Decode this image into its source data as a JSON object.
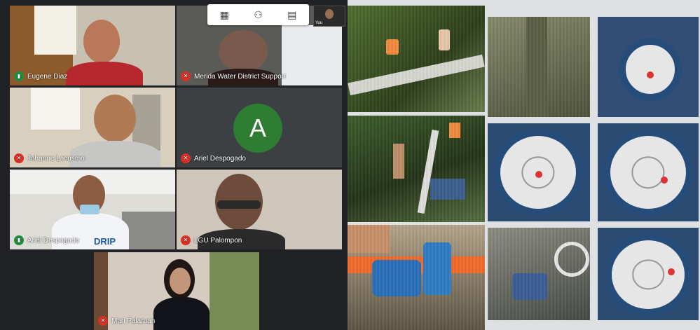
{
  "toolbar": {
    "icons": [
      "grid-icon",
      "people-icon",
      "chat-icon"
    ]
  },
  "participants": [
    {
      "name": "Eugene Diaz",
      "mic": "on"
    },
    {
      "name": "Merida Water District Support",
      "mic": "muted"
    },
    {
      "name": "Johanne Lacusmo",
      "mic": "muted"
    },
    {
      "name": "Ariel Despogado",
      "mic": "muted",
      "avatar_letter": "A",
      "avatar_color": "#2e7d32"
    },
    {
      "name": "Ariel Despogado",
      "mic": "on"
    },
    {
      "name": "LGU Palompon",
      "mic": "muted"
    },
    {
      "name": "Mari Palaruan",
      "mic": "muted"
    }
  ],
  "self_view": {
    "label": "You"
  },
  "shirt_text": "DRIP",
  "photos": [
    "field-work-pipes",
    "field-work-river",
    "water-meter-installation",
    "meter-trench",
    "water-meter-1",
    "water-meter-2",
    "water-meter-3",
    "water-meter-4",
    "water-meter-5"
  ]
}
